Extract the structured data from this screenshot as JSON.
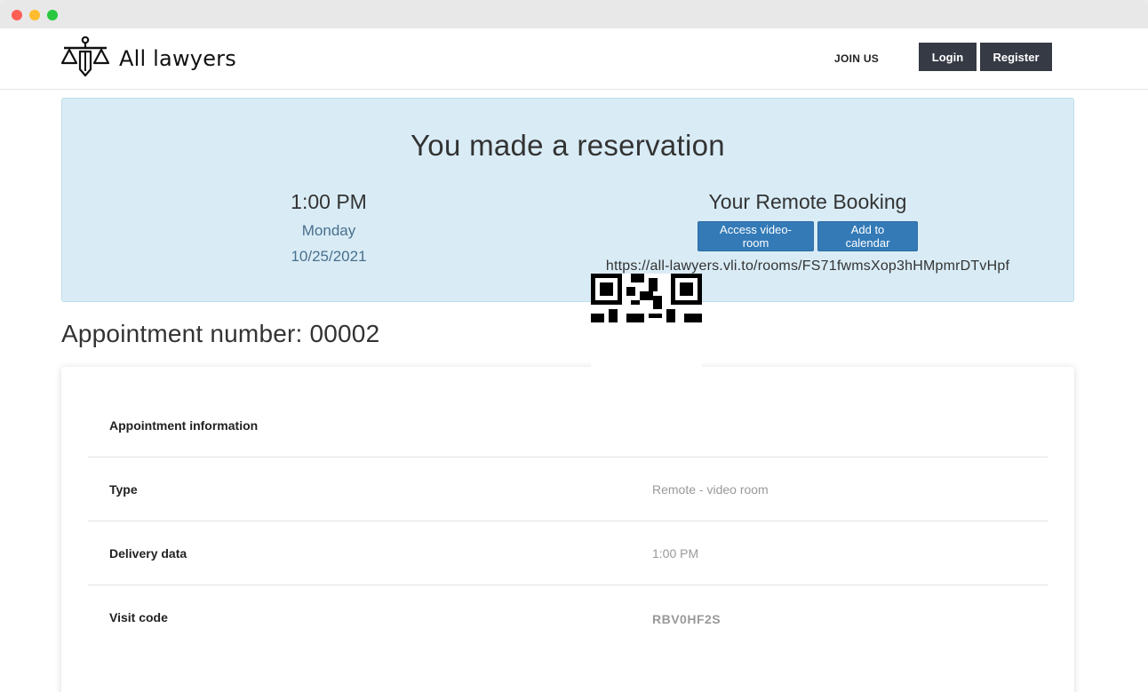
{
  "brand": {
    "name": "All lawyers",
    "logo_icon": "scales-of-justice-icon"
  },
  "nav": {
    "join_label": "JOIN US",
    "login_label": "Login",
    "register_label": "Register"
  },
  "reservation": {
    "heading": "You made a reservation",
    "time": "1:00 PM",
    "day": "Monday",
    "date": "10/25/2021",
    "remote_title": "Your Remote Booking",
    "video_button": "Access video-room",
    "calendar_button": "Add to calendar",
    "room_url": "https://all-lawyers.vli.to/rooms/FS71fwmsXop3hHMpmrDTvHpf"
  },
  "appointment": {
    "number_label": "Appointment number: 00002",
    "section_title": "Appointment information",
    "rows": [
      {
        "label": "Type",
        "value": "Remote - video room"
      },
      {
        "label": "Delivery data",
        "value": "1:00 PM"
      },
      {
        "label": "Visit code",
        "value": "RBV0HF2S"
      }
    ]
  },
  "colors": {
    "accent": "#337ab7",
    "alert_bg": "#d9ecf6",
    "dark_button": "#363a45"
  }
}
